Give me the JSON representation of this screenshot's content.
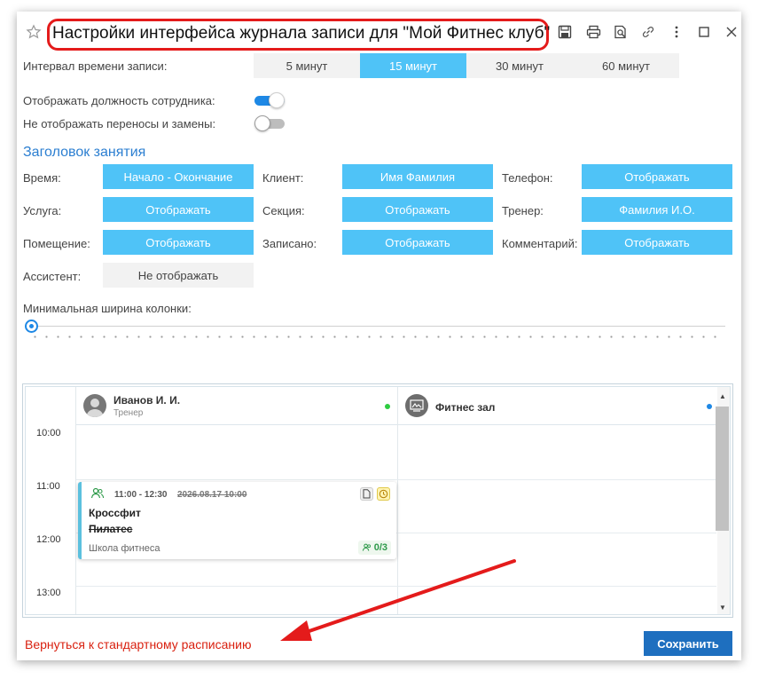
{
  "window": {
    "title": "Настройки интерфейса журнала записи для \"Мой Фитнес клуб\""
  },
  "interval": {
    "label": "Интервал времени записи:",
    "options": [
      "5 минут",
      "15 минут",
      "30 минут",
      "60 минут"
    ],
    "selected": "15 минут"
  },
  "toggles": [
    {
      "label": "Отображать должность сотрудника:",
      "on": true
    },
    {
      "label": "Не отображать переносы и замены:",
      "on": false
    }
  ],
  "header_section": {
    "title": "Заголовок занятия",
    "fields": [
      {
        "label": "Время:",
        "value": "Начало - Окончание"
      },
      {
        "label": "Клиент:",
        "value": "Имя Фамилия"
      },
      {
        "label": "Телефон:",
        "value": "Отображать"
      },
      {
        "label": "Услуга:",
        "value": "Отображать"
      },
      {
        "label": "Секция:",
        "value": "Отображать"
      },
      {
        "label": "Тренер:",
        "value": "Фамилия И.О."
      },
      {
        "label": "Помещение:",
        "value": "Отображать"
      },
      {
        "label": "Записано:",
        "value": "Отображать"
      },
      {
        "label": "Комментарий:",
        "value": "Отображать"
      },
      {
        "label": "Ассистент:",
        "value": "Не отображать"
      }
    ]
  },
  "slider": {
    "label": "Минимальная ширина колонки:",
    "value": 0
  },
  "schedule": {
    "columns": [
      {
        "name": "Иванов И. И.",
        "subtitle": "Тренер",
        "dot_color": "#2ecc40"
      },
      {
        "name": "Фитнес зал",
        "subtitle": "",
        "dot_color": "#1e88e5"
      }
    ],
    "times": [
      "10:00",
      "11:00",
      "12:00",
      "13:00"
    ],
    "event": {
      "time": "11:00 - 12:30",
      "old_time": "2026.08.17 10:00",
      "title": "Кроссфит",
      "old_title": "Пилатес",
      "club": "Школа фитнеса",
      "count": "0/3"
    }
  },
  "footer": {
    "back_link": "Вернуться к стандартному расписанию",
    "save_label": "Сохранить"
  },
  "colors": {
    "accent": "#4fc3f7",
    "primary": "#1e6fbf",
    "annotation": "#e41b1b"
  }
}
